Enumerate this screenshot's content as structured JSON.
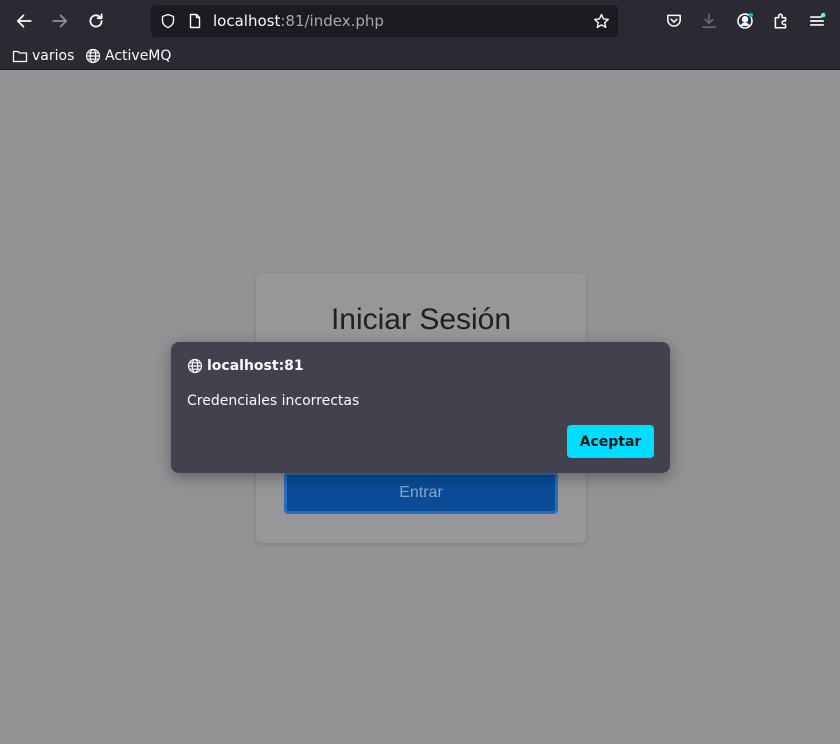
{
  "browser": {
    "url_host": "localhost",
    "url_rest": ":81/index.php",
    "bookmarks": [
      {
        "label": "varios",
        "icon": "folder-icon"
      },
      {
        "label": "ActiveMQ",
        "icon": "globe-icon"
      }
    ],
    "accent_dot_color": "#54ffbd"
  },
  "login": {
    "title": "Iniciar Sesión",
    "submit_label": "Entrar"
  },
  "dialog": {
    "origin": "localhost:81",
    "message": "Credenciales incorrectas",
    "accept_label": "Aceptar"
  }
}
